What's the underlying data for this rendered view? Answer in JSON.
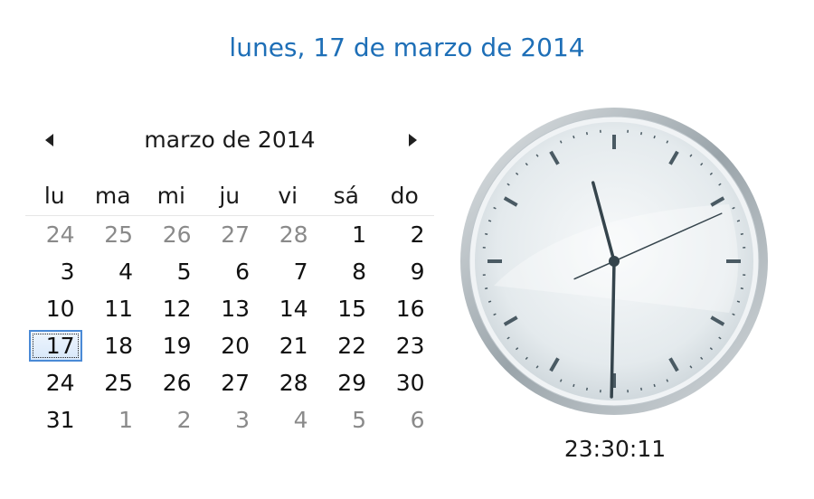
{
  "header": {
    "long_date": "lunes, 17 de marzo de 2014"
  },
  "calendar": {
    "month_title": "marzo de 2014",
    "weekdays": [
      "lu",
      "ma",
      "mi",
      "ju",
      "vi",
      "sá",
      "do"
    ],
    "rows": [
      [
        {
          "d": "24",
          "o": true
        },
        {
          "d": "25",
          "o": true
        },
        {
          "d": "26",
          "o": true
        },
        {
          "d": "27",
          "o": true
        },
        {
          "d": "28",
          "o": true
        },
        {
          "d": "1"
        },
        {
          "d": "2"
        }
      ],
      [
        {
          "d": "3"
        },
        {
          "d": "4"
        },
        {
          "d": "5"
        },
        {
          "d": "6"
        },
        {
          "d": "7"
        },
        {
          "d": "8"
        },
        {
          "d": "9"
        }
      ],
      [
        {
          "d": "10"
        },
        {
          "d": "11"
        },
        {
          "d": "12"
        },
        {
          "d": "13"
        },
        {
          "d": "14"
        },
        {
          "d": "15"
        },
        {
          "d": "16"
        }
      ],
      [
        {
          "d": "17",
          "t": true
        },
        {
          "d": "18"
        },
        {
          "d": "19"
        },
        {
          "d": "20"
        },
        {
          "d": "21"
        },
        {
          "d": "22"
        },
        {
          "d": "23"
        }
      ],
      [
        {
          "d": "24"
        },
        {
          "d": "25"
        },
        {
          "d": "26"
        },
        {
          "d": "27"
        },
        {
          "d": "28"
        },
        {
          "d": "29"
        },
        {
          "d": "30"
        }
      ],
      [
        {
          "d": "31"
        },
        {
          "d": "1",
          "o": true
        },
        {
          "d": "2",
          "o": true
        },
        {
          "d": "3",
          "o": true
        },
        {
          "d": "4",
          "o": true
        },
        {
          "d": "5",
          "o": true
        },
        {
          "d": "6",
          "o": true
        }
      ]
    ],
    "prev_icon": "triangle-left-icon",
    "next_icon": "triangle-right-icon"
  },
  "clock": {
    "time_text": "23:30:11",
    "hours": 23,
    "minutes": 30,
    "seconds": 11,
    "face_color": "#e9eef1",
    "rim_color": "#b9c1c6",
    "tick_color": "#4a5a63",
    "hand_color": "#35444c"
  },
  "colors": {
    "link": "#1e6fb7",
    "text": "#111111",
    "muted": "#8a8a8a",
    "today_border": "#4a8ad6"
  }
}
